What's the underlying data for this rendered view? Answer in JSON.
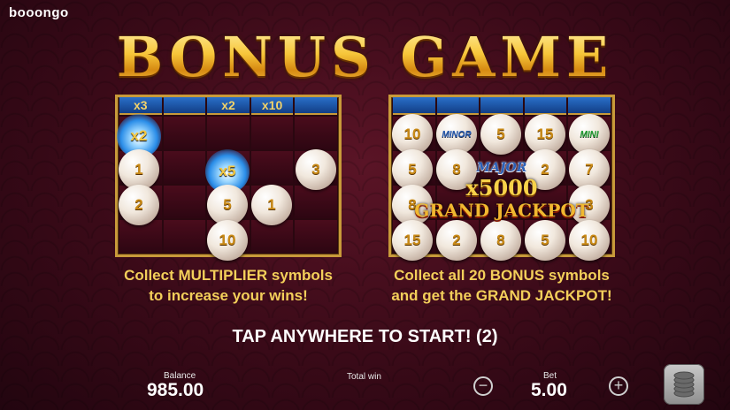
{
  "brand": "booongo",
  "title": "BONUS GAME",
  "left_panel": {
    "header_cells": [
      "x3",
      "",
      "x2",
      "x10",
      ""
    ],
    "pearls": [
      "1",
      "2",
      "5",
      "1",
      "3",
      "10"
    ],
    "multipliers": [
      "x2",
      "x5"
    ],
    "caption_line1": "Collect MULTIPLIER symbols",
    "caption_line2": "to increase your wins!"
  },
  "right_panel": {
    "pearls": [
      "10",
      "MINOR",
      "5",
      "15",
      "MINI",
      "5",
      "8",
      "2",
      "7",
      "8",
      "3",
      "15",
      "2",
      "8",
      "5",
      "10"
    ],
    "major_label": "MAJOR",
    "multiplier_label": "x5000",
    "grand_label": "GRAND JACKPOT",
    "caption_line1": "Collect all 20 BONUS symbols",
    "caption_line2": "and get the GRAND JACKPOT!"
  },
  "tap_text": "TAP ANYWHERE TO START! (2)",
  "footer": {
    "balance_label": "Balance",
    "balance_value": "985.00",
    "total_win_label": "Total win",
    "bet_label": "Bet",
    "bet_value": "5.00",
    "minus_icon": "minus-icon",
    "plus_icon": "plus-icon",
    "stack_icon": "coin-stack-icon"
  }
}
